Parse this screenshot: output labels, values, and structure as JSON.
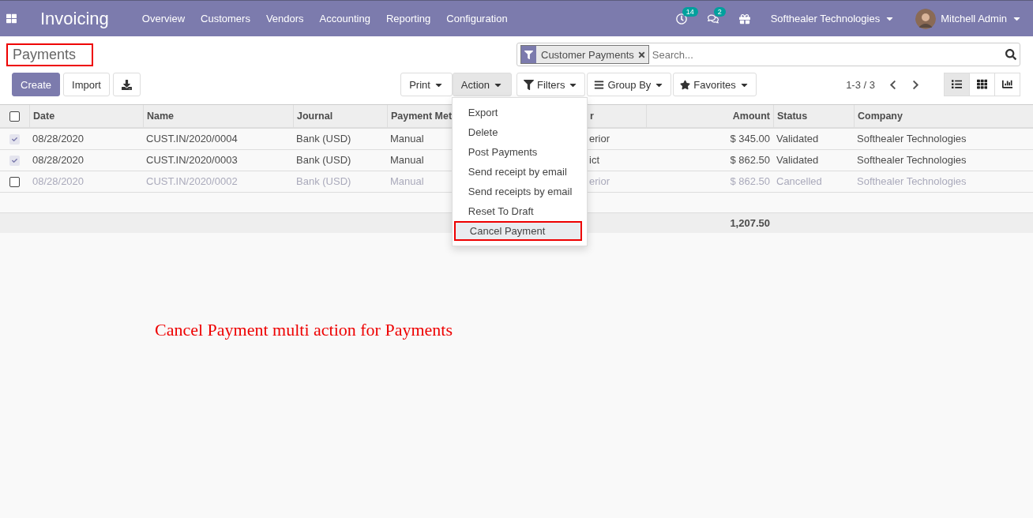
{
  "navbar": {
    "app_title": "Invoicing",
    "menu": [
      "Overview",
      "Customers",
      "Vendors",
      "Accounting",
      "Reporting",
      "Configuration"
    ],
    "activity_count": "14",
    "message_count": "2",
    "company": "Softhealer Technologies",
    "user": "Mitchell Admin"
  },
  "page_title": {
    "text": "Payments",
    "annotated": true
  },
  "buttons": {
    "create": "Create",
    "import": "Import",
    "print": "Print",
    "action": "Action"
  },
  "action_menu": [
    {
      "label": "Export",
      "selected": false,
      "annotated": false
    },
    {
      "label": "Delete",
      "selected": false,
      "annotated": false
    },
    {
      "label": "Post Payments",
      "selected": false,
      "annotated": false
    },
    {
      "label": "Send receipt by email",
      "selected": false,
      "annotated": false
    },
    {
      "label": "Send receipts by email",
      "selected": false,
      "annotated": false
    },
    {
      "label": "Reset To Draft",
      "selected": false,
      "annotated": false
    },
    {
      "label": "Cancel Payment",
      "selected": true,
      "annotated": true
    }
  ],
  "search": {
    "facet": "Customer Payments",
    "placeholder": "Search..."
  },
  "filters": [
    "Filters",
    "Group By",
    "Favorites"
  ],
  "pager": "1-3 / 3",
  "views": [
    {
      "kind": "list",
      "selected": true
    },
    {
      "kind": "kanban",
      "selected": false
    },
    {
      "kind": "graph",
      "selected": false
    }
  ],
  "table": {
    "all_checked": false,
    "columns": [
      "Date",
      "Name",
      "Journal",
      "Payment Met",
      "r",
      "Amount",
      "Status",
      "Company"
    ],
    "rows": [
      {
        "selected": true,
        "muted": false,
        "cells": [
          "08/28/2020",
          "CUST.IN/2020/0004",
          "Bank (USD)",
          "Manual",
          "erior",
          "$ 345.00",
          "Validated",
          "Softhealer Technologies"
        ]
      },
      {
        "selected": true,
        "muted": false,
        "cells": [
          "08/28/2020",
          "CUST.IN/2020/0003",
          "Bank (USD)",
          "Manual",
          "ict",
          "$ 862.50",
          "Validated",
          "Softhealer Technologies"
        ]
      },
      {
        "selected": false,
        "muted": true,
        "cells": [
          "08/28/2020",
          "CUST.IN/2020/0002",
          "Bank (USD)",
          "Manual",
          "erior",
          "$ 862.50",
          "Cancelled",
          "Softhealer Technologies"
        ]
      }
    ],
    "total": "1,207.50"
  },
  "caption": "Cancel Payment multi action for Payments"
}
